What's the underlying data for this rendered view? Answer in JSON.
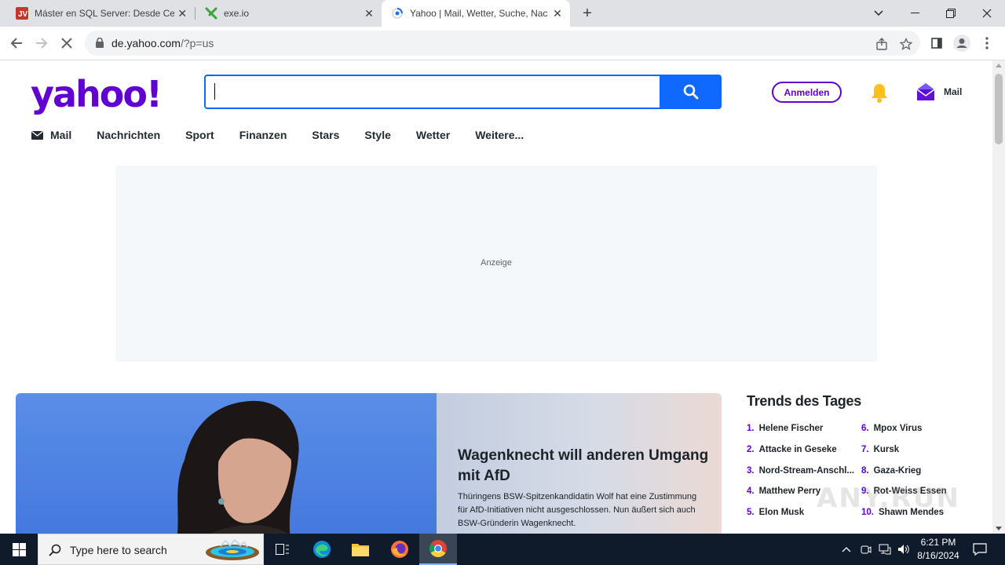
{
  "browser": {
    "tabs": [
      {
        "title": "Máster en SQL Server: Desde Cer",
        "icon": "udemy-favicon"
      },
      {
        "title": "exe.io",
        "icon": "exeio-favicon"
      },
      {
        "title": "Yahoo | Mail, Wetter, Suche, Nac",
        "icon": "yahoo-loading-favicon",
        "active": true
      }
    ],
    "url_host": "de.yahoo.com",
    "url_path": "/?p=us"
  },
  "yahoo": {
    "logo": "yahoo!",
    "search_placeholder": "",
    "signin_label": "Anmelden",
    "mail_label": "Mail",
    "nav": [
      "Mail",
      "Nachrichten",
      "Sport",
      "Finanzen",
      "Stars",
      "Style",
      "Wetter",
      "Weitere..."
    ],
    "ad_label": "Anzeige",
    "hero": {
      "title": "Wagenknecht will anderen Umgang mit AfD",
      "summary": "Thüringens BSW-Spitzenkandidatin Wolf hat eine Zustimmung für AfD-Initiativen nicht ausgeschlossen. Nun äußert sich auch BSW-Gründerin Wagenknecht."
    },
    "trends": {
      "title": "Trends des Tages",
      "items": [
        {
          "n": "1.",
          "label": "Helene Fischer"
        },
        {
          "n": "2.",
          "label": "Attacke in Geseke"
        },
        {
          "n": "3.",
          "label": "Nord-Stream-Anschl..."
        },
        {
          "n": "4.",
          "label": "Matthew Perry"
        },
        {
          "n": "5.",
          "label": "Elon Musk"
        },
        {
          "n": "6.",
          "label": "Mpox Virus"
        },
        {
          "n": "7.",
          "label": "Kursk"
        },
        {
          "n": "8.",
          "label": "Gaza-Krieg"
        },
        {
          "n": "9.",
          "label": "Rot-Weiss Essen"
        },
        {
          "n": "10.",
          "label": "Shawn Mendes"
        }
      ]
    }
  },
  "taskbar": {
    "search_placeholder": "Type here to search",
    "time": "6:21 PM",
    "date": "8/16/2024"
  },
  "watermark": "ANY.RUN",
  "colors": {
    "yahoo_purple": "#6001d2",
    "search_blue": "#0f69ff",
    "taskbar": "#0f1a2b"
  }
}
